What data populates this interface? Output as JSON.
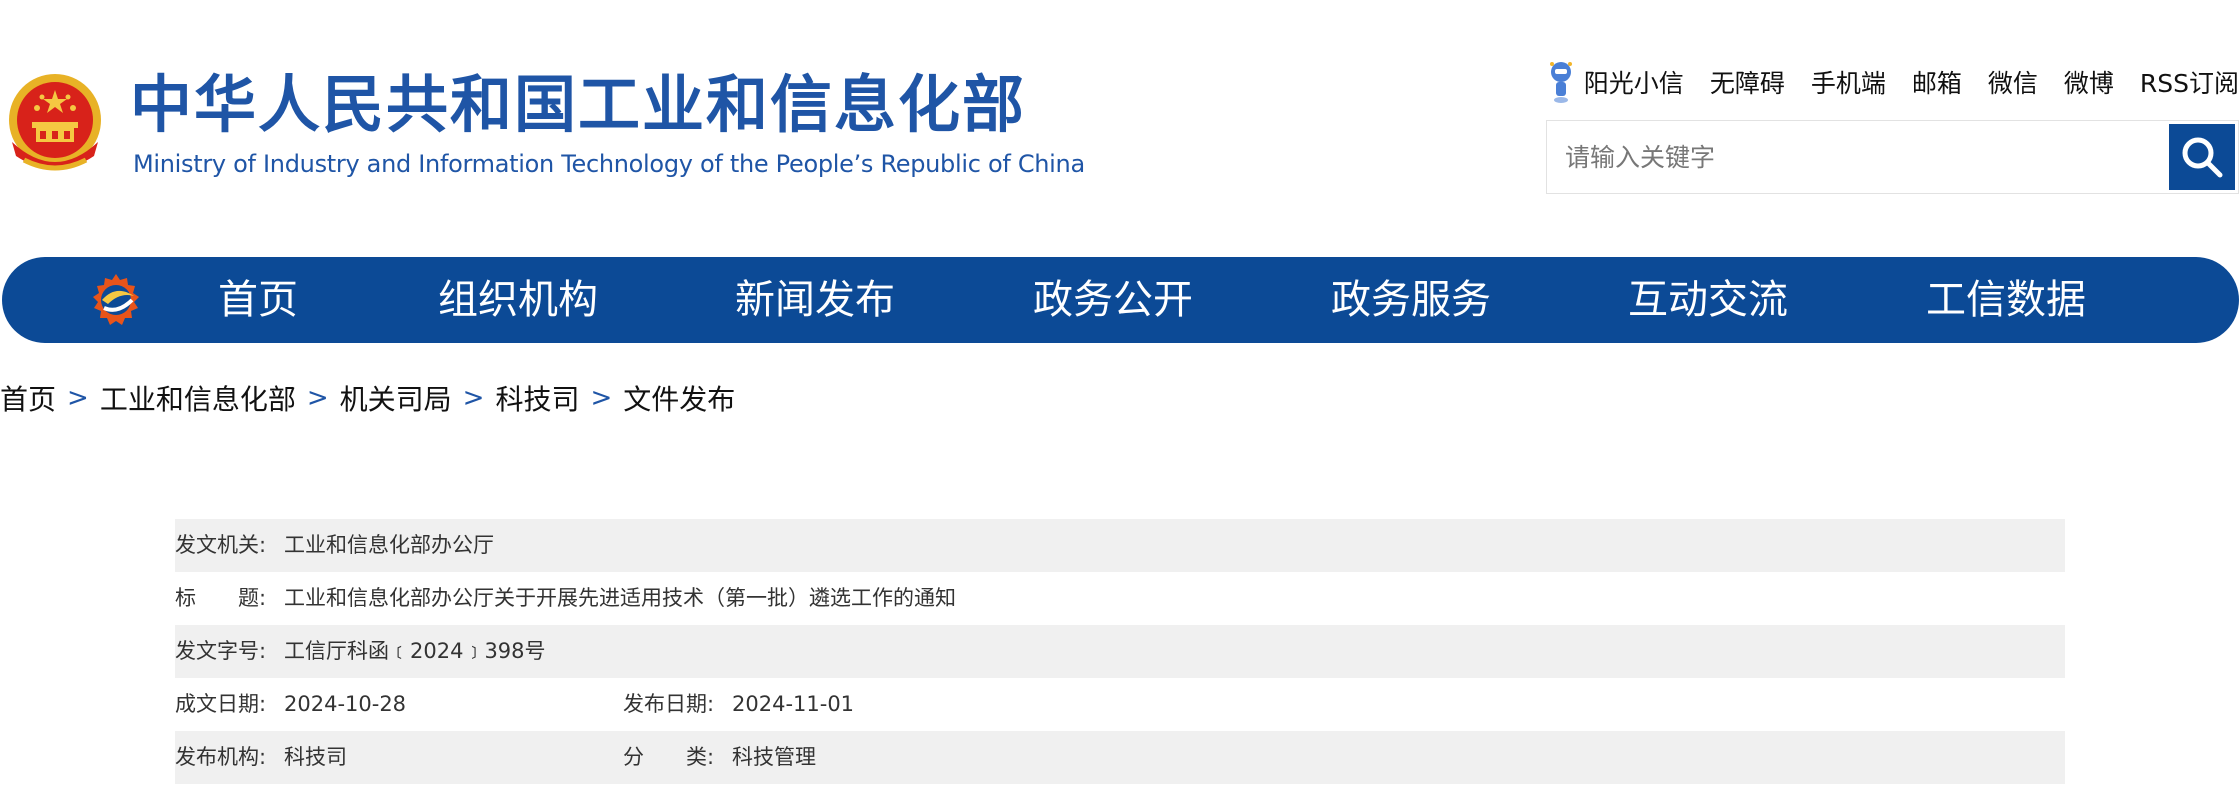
{
  "header": {
    "title": "中华人民共和国工业和信息化部",
    "subtitle": "Ministry of Industry and Information Technology of the People’s Republic of China",
    "toplinks": [
      "阳光小信",
      "无障碍",
      "手机端",
      "邮箱",
      "微信",
      "微博",
      "RSS订阅"
    ],
    "search_placeholder": "请输入关键字"
  },
  "nav": {
    "items": [
      "首页",
      "组织机构",
      "新闻发布",
      "政务公开",
      "政务服务",
      "互动交流",
      "工信数据"
    ]
  },
  "breadcrumb": {
    "items": [
      "首页",
      "工业和信息化部",
      "机关司局",
      "科技司",
      "文件发布"
    ],
    "separator": ">"
  },
  "info": {
    "issuer_label": "发文机关:",
    "issuer": "工业和信息化部办公厅",
    "title_label": "标　　题:",
    "title": "工业和信息化部办公厅关于开展先进适用技术（第一批）遴选工作的通知",
    "docno_label": "发文字号:",
    "docno": "工信厅科函﹝2024﹞398号",
    "written_label": "成文日期:",
    "written": "2024-10-28",
    "published_label": "发布日期:",
    "published": "2024-11-01",
    "org_label": "发布机构:",
    "org": "科技司",
    "category_label": "分　　类:",
    "category": "科技管理"
  },
  "colors": {
    "brand_blue": "#0c4a96",
    "title_blue": "#1f55a6",
    "row_shade": "#f0f0f0"
  }
}
